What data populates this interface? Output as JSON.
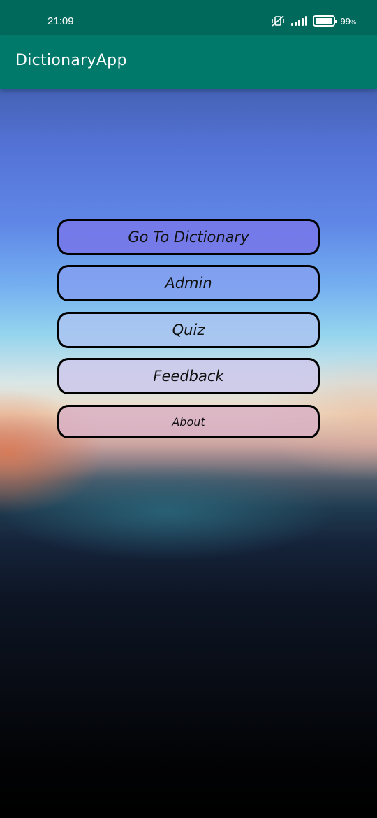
{
  "status_bar": {
    "time": "21:09",
    "battery_percent": "99",
    "battery_unit": "%",
    "icons": [
      "mute-vibrate-icon",
      "signal-icon",
      "battery-icon"
    ]
  },
  "app_bar": {
    "title": "DictionaryApp",
    "color": "#00796b"
  },
  "menu": {
    "buttons": [
      {
        "label": "Go To Dictionary"
      },
      {
        "label": "Admin"
      },
      {
        "label": "Quiz"
      },
      {
        "label": "Feedback"
      },
      {
        "label": "About"
      }
    ]
  }
}
